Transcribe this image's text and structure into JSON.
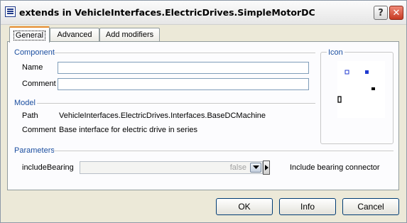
{
  "window": {
    "title": "extends in VehicleInterfaces.ElectricDrives.SimpleMotorDC"
  },
  "titlebar_buttons": {
    "help": "?",
    "close": "✕"
  },
  "tabs": [
    {
      "label": "General",
      "active": true
    },
    {
      "label": "Advanced",
      "active": false
    },
    {
      "label": "Add modifiers",
      "active": false
    }
  ],
  "component": {
    "section": "Component",
    "name_label": "Name",
    "name_value": "",
    "comment_label": "Comment",
    "comment_value": ""
  },
  "icon": {
    "section": "Icon"
  },
  "model": {
    "section": "Model",
    "path_label": "Path",
    "path_value": "VehicleInterfaces.ElectricDrives.Interfaces.BaseDCMachine",
    "comment_label": "Comment",
    "comment_value": "Base interface for electric drive in series"
  },
  "parameters": {
    "section": "Parameters",
    "include_bearing_label": "includeBearing",
    "include_bearing_value": "false",
    "include_bearing_description": "Include bearing connector"
  },
  "buttons": {
    "ok": "OK",
    "info": "Info",
    "cancel": "Cancel"
  },
  "colors": {
    "section_label": "#1c4fa0",
    "close_button": "#c63a22",
    "active_tab_accent": "#e68b2c"
  }
}
